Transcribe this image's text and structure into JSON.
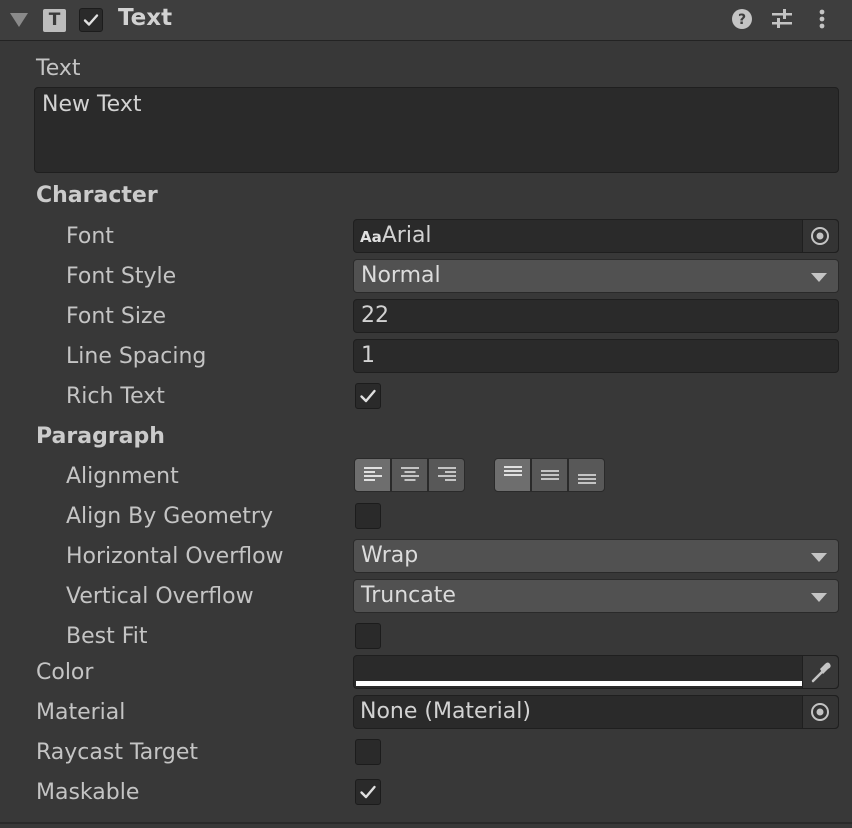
{
  "component": {
    "type_icon": "T",
    "title": "Text",
    "enabled": true,
    "header_icons": [
      "help-icon",
      "presets-icon",
      "more-icon"
    ]
  },
  "text": {
    "label": "Text",
    "value": "New Text"
  },
  "character": {
    "header": "Character",
    "font_label": "Font",
    "font_icon": "Aa",
    "font_value": "Arial",
    "font_style_label": "Font Style",
    "font_style_value": "Normal",
    "font_size_label": "Font Size",
    "font_size_value": "22",
    "line_spacing_label": "Line Spacing",
    "line_spacing_value": "1",
    "rich_text_label": "Rich Text",
    "rich_text_checked": true
  },
  "paragraph": {
    "header": "Paragraph",
    "alignment_label": "Alignment",
    "horizontal_alignment": [
      "left",
      "center",
      "right"
    ],
    "horizontal_selected": "left",
    "vertical_alignment": [
      "top",
      "middle",
      "bottom"
    ],
    "vertical_selected": "top",
    "align_by_geometry_label": "Align By Geometry",
    "align_by_geometry_checked": false,
    "horizontal_overflow_label": "Horizontal Overflow",
    "horizontal_overflow_value": "Wrap",
    "vertical_overflow_label": "Vertical Overflow",
    "vertical_overflow_value": "Truncate",
    "best_fit_label": "Best Fit",
    "best_fit_checked": false
  },
  "color": {
    "label": "Color",
    "value": "#FFFFFF"
  },
  "material": {
    "label": "Material",
    "value": "None (Material)"
  },
  "raycast_target": {
    "label": "Raycast Target",
    "checked": false
  },
  "maskable": {
    "label": "Maskable",
    "checked": true
  }
}
